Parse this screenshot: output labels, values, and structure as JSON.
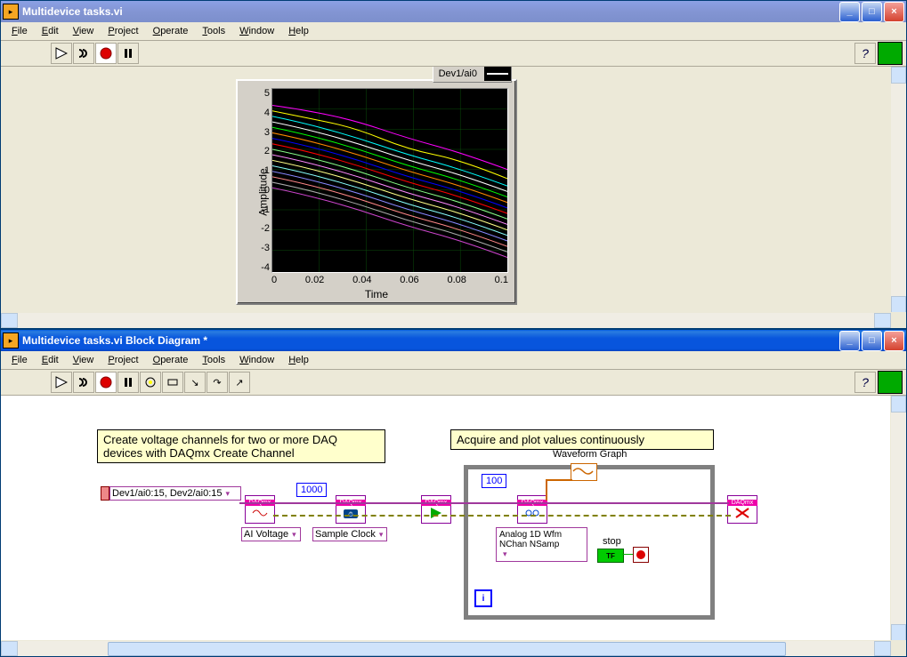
{
  "front_panel": {
    "title": "Multidevice tasks.vi",
    "menus": [
      "File",
      "Edit",
      "View",
      "Project",
      "Operate",
      "Tools",
      "Window",
      "Help"
    ],
    "legend_label": "Dev1/ai0",
    "y_label": "Amplitude",
    "x_label": "Time",
    "y_ticks": [
      "5",
      "4",
      "3",
      "2",
      "1",
      "0",
      "-1",
      "-2",
      "-3",
      "-4"
    ],
    "x_ticks": [
      "0",
      "0.02",
      "0.04",
      "0.06",
      "0.08",
      "0.1"
    ]
  },
  "block_diagram": {
    "title": "Multidevice tasks.vi Block Diagram *",
    "menus": [
      "File",
      "Edit",
      "View",
      "Project",
      "Operate",
      "Tools",
      "Window",
      "Help"
    ],
    "comment1": "Create voltage channels for two or more DAQ devices with DAQmx Create Channel",
    "comment2": "Acquire and plot values continuously",
    "channel_string": "Dev1/ai0:15, Dev2/ai0:15",
    "rate": "1000",
    "samples": "100",
    "ai_selector": "AI Voltage",
    "clock_selector": "Sample Clock",
    "read_selector": "Analog 1D Wfm NChan NSamp",
    "graph_label": "Waveform Graph",
    "stop_label": "stop",
    "tf": "TF",
    "daqmx": "DAQmx",
    "iter": "i"
  },
  "chart_data": {
    "type": "line",
    "title": "",
    "xlabel": "Time",
    "ylabel": "Amplitude",
    "xlim": [
      0,
      0.1
    ],
    "ylim": [
      -4,
      5
    ],
    "note": "Multiple noisy declining waveform traces (32 channels approx), each drifting from roughly +4..+1 at t=0 down to -1..-4 at t=0.1",
    "series_count": 32
  }
}
